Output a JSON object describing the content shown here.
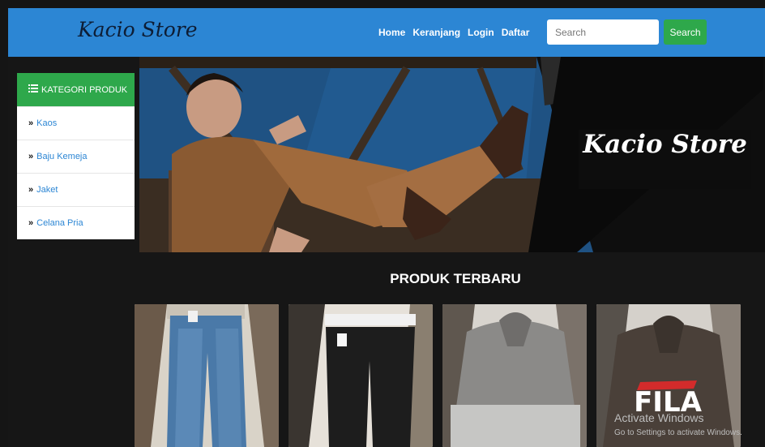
{
  "header": {
    "brand": "Kacio Store",
    "nav": [
      "Home",
      "Keranjang",
      "Login",
      "Daftar"
    ],
    "search_placeholder": "Search",
    "search_button": "Search"
  },
  "sidebar": {
    "title": "KATEGORI PRODUK",
    "items": [
      "Kaos",
      "Baju Kemeja",
      "Jaket",
      "Celana Pria"
    ]
  },
  "banner": {
    "title": "Kacio Store"
  },
  "products": {
    "section_title": "PRODUK TERBARU",
    "logo_text": "FILA"
  },
  "watermark": {
    "line1": "Activate Windows",
    "line2": "Go to Settings to activate Windows."
  },
  "colors": {
    "navbar": "#2c86d4",
    "green": "#2ea84b",
    "background": "#151515"
  },
  "icons": {
    "category": "list-icon",
    "item": "double-chevron-right-icon"
  }
}
